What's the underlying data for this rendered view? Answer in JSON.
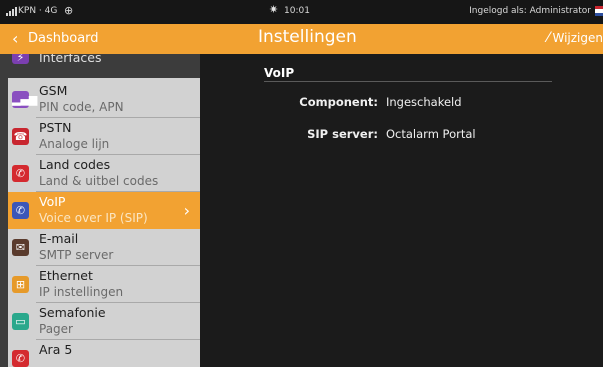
{
  "status_bar": {
    "carrier": "KPN · 4G",
    "time": "10:01",
    "login": "Ingelogd als: Administrator",
    "icons": [
      "signal-icon",
      "globe-icon",
      "brightness-icon",
      "flag-nl-icon"
    ]
  },
  "header": {
    "back_label": "Dashboard",
    "title": "Instellingen",
    "edit_label": "Wijzigen",
    "color": "#f2a232"
  },
  "sidebar": {
    "items": [
      {
        "title": "Interfaces",
        "subtitle": "",
        "icon": "interfaces-icon",
        "icon_color": "#7b3fb0",
        "glyph": "⚡"
      },
      {
        "title": "GSM",
        "subtitle": "PIN code, APN",
        "icon": "gsm-signal-icon",
        "icon_color": "#8a4fc0",
        "glyph": "▂▄▆"
      },
      {
        "title": "PSTN",
        "subtitle": "Analoge lijn",
        "icon": "phone-icon",
        "icon_color": "#c8262f",
        "glyph": "☎"
      },
      {
        "title": "Land codes",
        "subtitle": "Land & uitbel codes",
        "icon": "handset-icon",
        "icon_color": "#d42a2f",
        "glyph": "✆"
      },
      {
        "title": "VoIP",
        "subtitle": "Voice over IP (SIP)",
        "icon": "voip-phone-icon",
        "icon_color": "#3c57b8",
        "glyph": "✆"
      },
      {
        "title": "E-mail",
        "subtitle": "SMTP server",
        "icon": "envelope-icon",
        "icon_color": "#5a3b2d",
        "glyph": "✉"
      },
      {
        "title": "Ethernet",
        "subtitle": "IP instellingen",
        "icon": "network-icon",
        "icon_color": "#e69a2a",
        "glyph": "⊞"
      },
      {
        "title": "Semafonie",
        "subtitle": "Pager",
        "icon": "pager-icon",
        "icon_color": "#2aa88c",
        "glyph": "▭"
      },
      {
        "title": "Ara 5",
        "subtitle": "",
        "icon": "ara-icon",
        "icon_color": "#d42a2f",
        "glyph": "✆"
      }
    ],
    "active_index": 4
  },
  "main": {
    "section_title": "VoIP",
    "fields": [
      {
        "label": "Component:",
        "value": "Ingeschakeld"
      },
      {
        "label": "SIP server:",
        "value": "Octalarm Portal"
      }
    ]
  }
}
